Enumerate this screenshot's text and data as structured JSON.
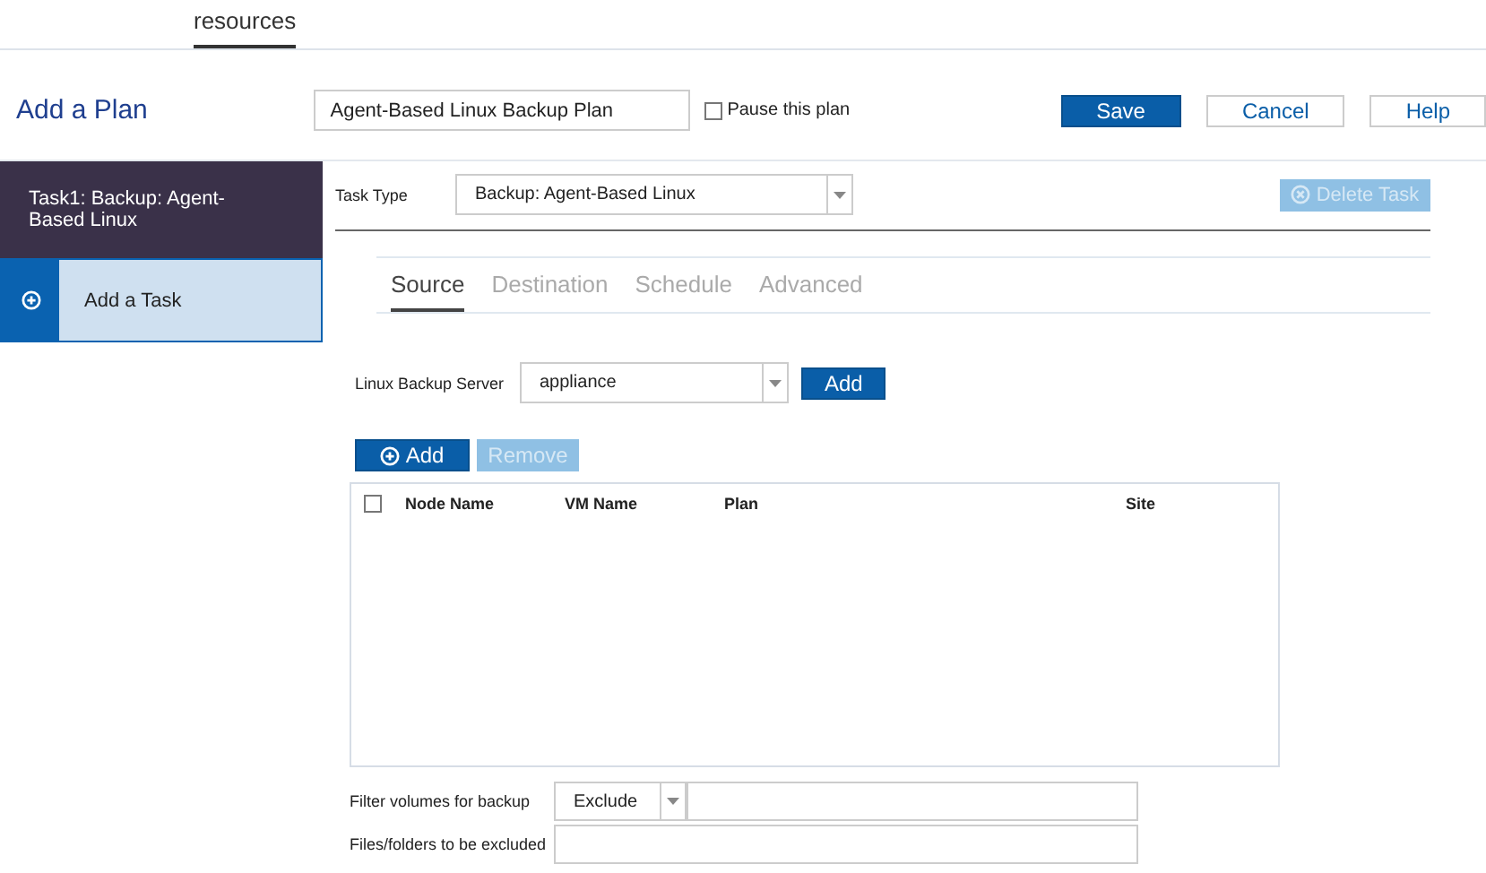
{
  "top_tab": {
    "label": "resources",
    "selected": true
  },
  "header": {
    "title": "Add a Plan",
    "plan_name": "Agent-Based Linux Backup Plan",
    "pause": {
      "label": "Pause this plan",
      "checked": false
    },
    "buttons": [
      {
        "label": "Save",
        "kind": "primary"
      },
      {
        "label": "Cancel",
        "kind": "secondary"
      },
      {
        "label": "Help",
        "kind": "secondary"
      }
    ]
  },
  "sidebar": {
    "items": [
      {
        "label": "Task1: Backup: Agent-Based Linux",
        "kind": "task",
        "selected": true
      },
      {
        "label": "Add a Task",
        "kind": "add",
        "selected": false
      }
    ]
  },
  "task_type": {
    "label": "Task Type",
    "value": "Backup: Agent-Based Linux"
  },
  "delete_task": {
    "label": "Delete Task",
    "disabled": true
  },
  "tabs": [
    {
      "label": "Source",
      "selected": true
    },
    {
      "label": "Destination",
      "selected": false
    },
    {
      "label": "Schedule",
      "selected": false
    },
    {
      "label": "Advanced",
      "selected": false
    }
  ],
  "server": {
    "label": "Linux Backup Server",
    "value": "appliance",
    "button": "Add"
  },
  "node_buttons": [
    {
      "label": "Add",
      "kind": "add",
      "disabled": false
    },
    {
      "label": "Remove",
      "kind": "plain",
      "disabled": true
    }
  ],
  "table": {
    "select_all": false,
    "columns": [
      "Node Name",
      "VM Name",
      "Plan",
      "Site"
    ]
  },
  "filter": {
    "label": "Filter volumes for backup",
    "mode": "Exclude"
  },
  "excluded": {
    "label": "Files/folders to be excluded"
  }
}
